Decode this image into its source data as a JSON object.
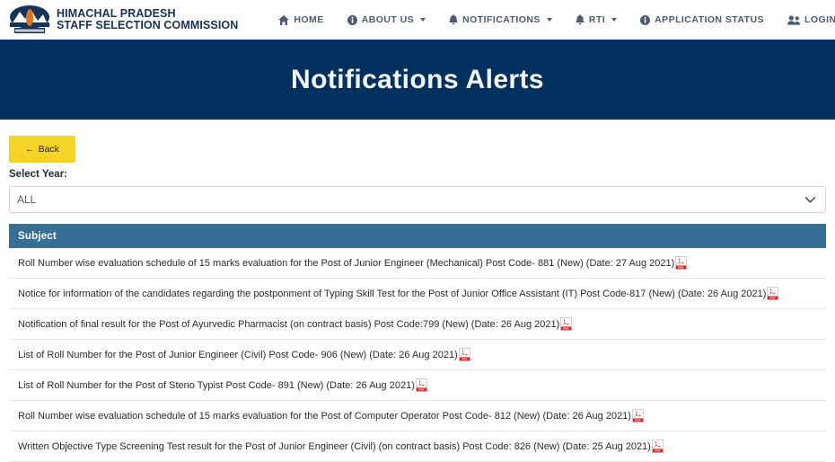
{
  "brand": {
    "line1": "HIMACHAL PRADESH",
    "line2": "STAFF SELECTION COMMISSION",
    "logo_icon": "hpssc-mountain-emblem-icon"
  },
  "nav": {
    "items": [
      {
        "label": "HOME",
        "icon": "home-icon",
        "caret": false
      },
      {
        "label": "ABOUT US",
        "icon": "info-circle-icon",
        "caret": true
      },
      {
        "label": "NOTIFICATIONS",
        "icon": "bell-icon",
        "caret": true
      },
      {
        "label": "RTI",
        "icon": "bell-icon",
        "caret": true
      },
      {
        "label": "APPLICATION STATUS",
        "icon": "info-circle-icon",
        "caret": false
      },
      {
        "label": "LOGIN",
        "icon": "users-icon",
        "caret": false
      }
    ]
  },
  "banner": {
    "title": "Notifications Alerts"
  },
  "toolbar": {
    "back_label": "Back",
    "back_icon": "arrow-left-icon"
  },
  "filter": {
    "label": "Select Year:",
    "selected": "ALL",
    "options": [
      "ALL"
    ],
    "chevron_icon": "chevron-down-icon"
  },
  "table": {
    "columns": [
      "Subject"
    ],
    "rows": [
      {
        "subject": "Roll Number wise evaluation schedule of 15 marks evaluation for the Post of Junior Engineer (Mechanical) Post Code- 881 (New) (Date: 27 Aug 2021)",
        "file_icon": "pdf-icon"
      },
      {
        "subject": "Notice for information of the candidates regarding the postponment of Typing Skill Test for the Post of Junior Office Assistant (IT) Post Code-817 (New) (Date: 26 Aug 2021)",
        "file_icon": "pdf-icon"
      },
      {
        "subject": "Notification of final result for the Post of Ayurvedic Pharmacist (on contract basis) Post Code:799 (New) (Date: 26 Aug 2021)",
        "file_icon": "pdf-icon"
      },
      {
        "subject": "List of Roll Number for the Post of Junior Engineer (Civil) Post Code- 906 (New) (Date: 26 Aug 2021)",
        "file_icon": "pdf-icon"
      },
      {
        "subject": "List of Roll Number for the Post of Steno Typist Post Code- 891 (New) (Date: 26 Aug 2021)",
        "file_icon": "pdf-icon"
      },
      {
        "subject": "Roll Number wise evaluation schedule of 15 marks evaluation for the Post of Computer Operator Post Code- 812 (New) (Date: 26 Aug 2021)",
        "file_icon": "pdf-icon"
      },
      {
        "subject": "Written Objective Type Screening Test result for the Post of Junior Engineer (Civil) (on contract basis) Post Code: 826 (New) (Date: 25 Aug 2021)",
        "file_icon": "pdf-icon"
      }
    ]
  },
  "colors": {
    "banner_bg": "#023160",
    "brand_text": "#16335c",
    "nav_text": "#4a5b73",
    "back_btn_bg": "#f5d327",
    "table_header_bg": "#366f96",
    "pdf_red": "#e02020"
  }
}
